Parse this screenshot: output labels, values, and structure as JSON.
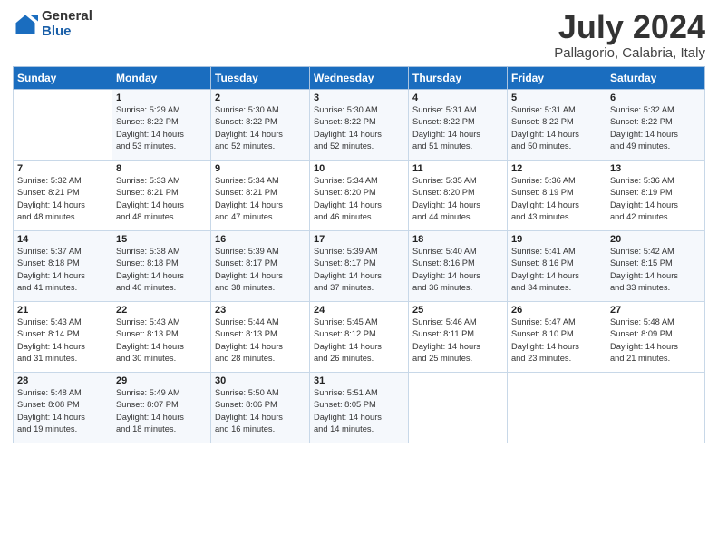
{
  "logo": {
    "general": "General",
    "blue": "Blue"
  },
  "title": {
    "month_year": "July 2024",
    "location": "Pallagorio, Calabria, Italy"
  },
  "headers": [
    "Sunday",
    "Monday",
    "Tuesday",
    "Wednesday",
    "Thursday",
    "Friday",
    "Saturday"
  ],
  "weeks": [
    [
      {
        "day": "",
        "info": ""
      },
      {
        "day": "1",
        "info": "Sunrise: 5:29 AM\nSunset: 8:22 PM\nDaylight: 14 hours\nand 53 minutes."
      },
      {
        "day": "2",
        "info": "Sunrise: 5:30 AM\nSunset: 8:22 PM\nDaylight: 14 hours\nand 52 minutes."
      },
      {
        "day": "3",
        "info": "Sunrise: 5:30 AM\nSunset: 8:22 PM\nDaylight: 14 hours\nand 52 minutes."
      },
      {
        "day": "4",
        "info": "Sunrise: 5:31 AM\nSunset: 8:22 PM\nDaylight: 14 hours\nand 51 minutes."
      },
      {
        "day": "5",
        "info": "Sunrise: 5:31 AM\nSunset: 8:22 PM\nDaylight: 14 hours\nand 50 minutes."
      },
      {
        "day": "6",
        "info": "Sunrise: 5:32 AM\nSunset: 8:22 PM\nDaylight: 14 hours\nand 49 minutes."
      }
    ],
    [
      {
        "day": "7",
        "info": "Sunrise: 5:32 AM\nSunset: 8:21 PM\nDaylight: 14 hours\nand 48 minutes."
      },
      {
        "day": "8",
        "info": "Sunrise: 5:33 AM\nSunset: 8:21 PM\nDaylight: 14 hours\nand 48 minutes."
      },
      {
        "day": "9",
        "info": "Sunrise: 5:34 AM\nSunset: 8:21 PM\nDaylight: 14 hours\nand 47 minutes."
      },
      {
        "day": "10",
        "info": "Sunrise: 5:34 AM\nSunset: 8:20 PM\nDaylight: 14 hours\nand 46 minutes."
      },
      {
        "day": "11",
        "info": "Sunrise: 5:35 AM\nSunset: 8:20 PM\nDaylight: 14 hours\nand 44 minutes."
      },
      {
        "day": "12",
        "info": "Sunrise: 5:36 AM\nSunset: 8:19 PM\nDaylight: 14 hours\nand 43 minutes."
      },
      {
        "day": "13",
        "info": "Sunrise: 5:36 AM\nSunset: 8:19 PM\nDaylight: 14 hours\nand 42 minutes."
      }
    ],
    [
      {
        "day": "14",
        "info": "Sunrise: 5:37 AM\nSunset: 8:18 PM\nDaylight: 14 hours\nand 41 minutes."
      },
      {
        "day": "15",
        "info": "Sunrise: 5:38 AM\nSunset: 8:18 PM\nDaylight: 14 hours\nand 40 minutes."
      },
      {
        "day": "16",
        "info": "Sunrise: 5:39 AM\nSunset: 8:17 PM\nDaylight: 14 hours\nand 38 minutes."
      },
      {
        "day": "17",
        "info": "Sunrise: 5:39 AM\nSunset: 8:17 PM\nDaylight: 14 hours\nand 37 minutes."
      },
      {
        "day": "18",
        "info": "Sunrise: 5:40 AM\nSunset: 8:16 PM\nDaylight: 14 hours\nand 36 minutes."
      },
      {
        "day": "19",
        "info": "Sunrise: 5:41 AM\nSunset: 8:16 PM\nDaylight: 14 hours\nand 34 minutes."
      },
      {
        "day": "20",
        "info": "Sunrise: 5:42 AM\nSunset: 8:15 PM\nDaylight: 14 hours\nand 33 minutes."
      }
    ],
    [
      {
        "day": "21",
        "info": "Sunrise: 5:43 AM\nSunset: 8:14 PM\nDaylight: 14 hours\nand 31 minutes."
      },
      {
        "day": "22",
        "info": "Sunrise: 5:43 AM\nSunset: 8:13 PM\nDaylight: 14 hours\nand 30 minutes."
      },
      {
        "day": "23",
        "info": "Sunrise: 5:44 AM\nSunset: 8:13 PM\nDaylight: 14 hours\nand 28 minutes."
      },
      {
        "day": "24",
        "info": "Sunrise: 5:45 AM\nSunset: 8:12 PM\nDaylight: 14 hours\nand 26 minutes."
      },
      {
        "day": "25",
        "info": "Sunrise: 5:46 AM\nSunset: 8:11 PM\nDaylight: 14 hours\nand 25 minutes."
      },
      {
        "day": "26",
        "info": "Sunrise: 5:47 AM\nSunset: 8:10 PM\nDaylight: 14 hours\nand 23 minutes."
      },
      {
        "day": "27",
        "info": "Sunrise: 5:48 AM\nSunset: 8:09 PM\nDaylight: 14 hours\nand 21 minutes."
      }
    ],
    [
      {
        "day": "28",
        "info": "Sunrise: 5:48 AM\nSunset: 8:08 PM\nDaylight: 14 hours\nand 19 minutes."
      },
      {
        "day": "29",
        "info": "Sunrise: 5:49 AM\nSunset: 8:07 PM\nDaylight: 14 hours\nand 18 minutes."
      },
      {
        "day": "30",
        "info": "Sunrise: 5:50 AM\nSunset: 8:06 PM\nDaylight: 14 hours\nand 16 minutes."
      },
      {
        "day": "31",
        "info": "Sunrise: 5:51 AM\nSunset: 8:05 PM\nDaylight: 14 hours\nand 14 minutes."
      },
      {
        "day": "",
        "info": ""
      },
      {
        "day": "",
        "info": ""
      },
      {
        "day": "",
        "info": ""
      }
    ]
  ]
}
